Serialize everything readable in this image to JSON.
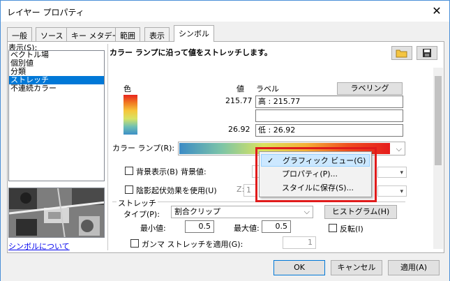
{
  "window": {
    "title": "レイヤー プロパティ",
    "close_glyph": "✕"
  },
  "tabs": [
    {
      "label": "一般"
    },
    {
      "label": "ソース"
    },
    {
      "label": "キー メタデータ"
    },
    {
      "label": "範囲"
    },
    {
      "label": "表示"
    },
    {
      "label": "シンボル",
      "active": true
    }
  ],
  "sidebar": {
    "show_label": "表示(S):",
    "items": [
      {
        "label": "ベクトル場"
      },
      {
        "label": "個別値"
      },
      {
        "label": "分類"
      },
      {
        "label": "ストレッチ",
        "selected": true
      },
      {
        "label": "不連続カラー"
      }
    ],
    "about_link": "シンボルについて"
  },
  "main": {
    "header": "カラー ランプに沿って値をストレッチします。",
    "color_label": "色",
    "value_label": "値",
    "label_col": "ラベル",
    "labeling_button": "ラベリング",
    "high_value": "215.77",
    "high_label": "高 : 215.77",
    "mid_label": "",
    "low_value": "26.92",
    "low_label": "低 : 26.92",
    "color_ramp_label": "カラー ランプ(R):",
    "background_label": "背景表示(B)",
    "background_value_label": "背景値:",
    "hillshade_label": "陰影起伏効果を使用(U)",
    "z_label": "Z:",
    "z_value": "1",
    "stretch_group": "ストレッチ",
    "type_label": "タイプ(P):",
    "type_value": "割合クリップ",
    "histogram_button": "ヒストグラム(H)",
    "min_label": "最小値:",
    "min_value": "0.5",
    "max_label": "最大値:",
    "max_value": "0.5",
    "invert_label": "反転(I)",
    "gamma_label": "ガンマ ストレッチを適用(G):",
    "gamma_value": "1"
  },
  "context_menu": {
    "items": [
      {
        "label": "グラフィック ビュー(G)",
        "checked": true
      },
      {
        "label": "プロパティ(P)..."
      },
      {
        "label": "スタイルに保存(S)..."
      }
    ]
  },
  "footer": {
    "ok": "OK",
    "cancel": "キャンセル",
    "apply": "適用(A)"
  },
  "colors": {
    "accent": "#0078d7",
    "highlight_box": "#e01b1b"
  }
}
